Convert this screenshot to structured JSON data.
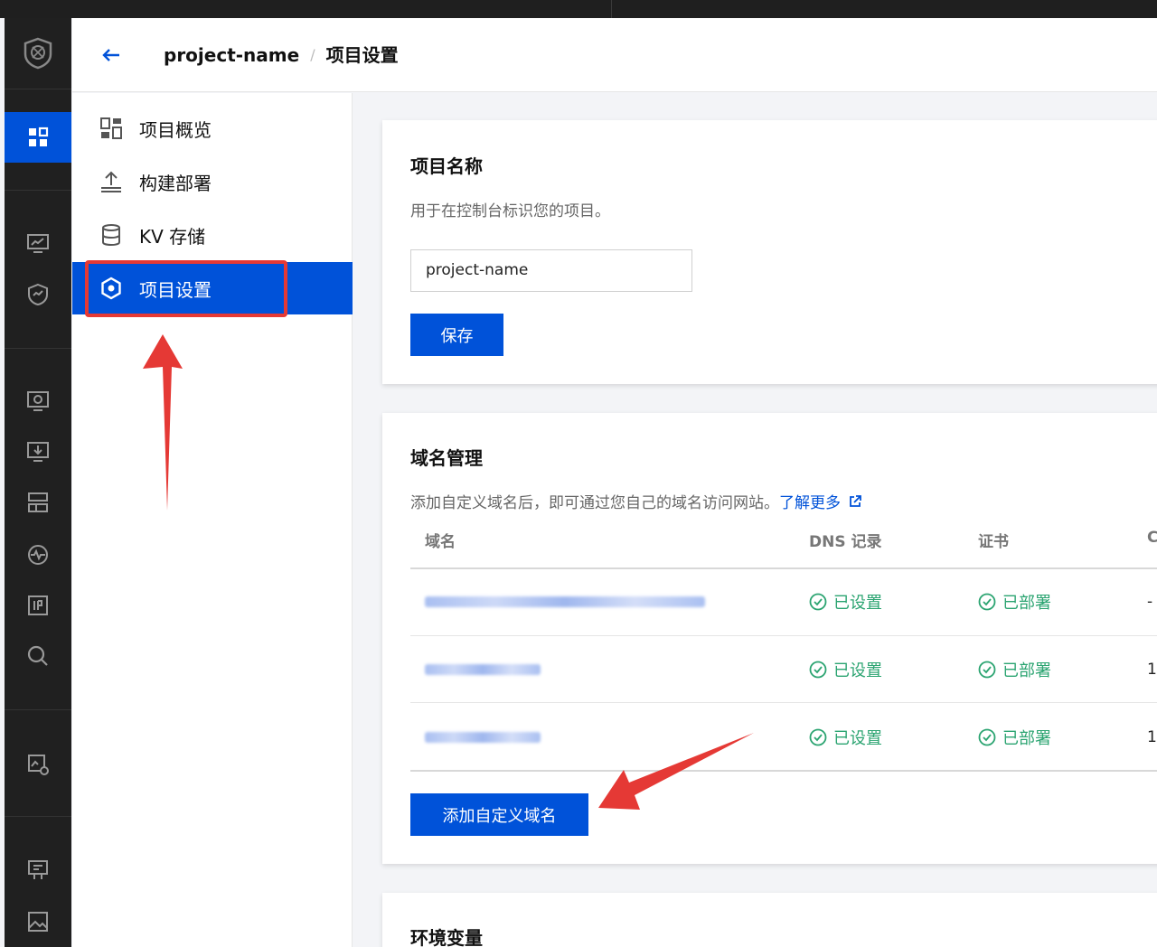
{
  "header": {
    "back_icon": "arrow-left-icon",
    "project": "project-name",
    "separator": "/",
    "page": "项目设置"
  },
  "sidenav": {
    "items": [
      {
        "label": "项目概览",
        "icon": "dashboard-icon"
      },
      {
        "label": "构建部署",
        "icon": "upload-icon"
      },
      {
        "label": "KV 存储",
        "icon": "database-icon"
      },
      {
        "label": "项目设置",
        "icon": "settings-icon",
        "selected": true
      }
    ]
  },
  "project_name_card": {
    "title": "项目名称",
    "description": "用于在控制台标识您的项目。",
    "input_value": "project-name",
    "save_label": "保存"
  },
  "domain_card": {
    "title": "域名管理",
    "description": "添加自定义域名后，即可通过您自己的域名访问网站。",
    "learn_more": "了解更多",
    "columns": [
      "域名",
      "DNS 记录",
      "证书",
      "C"
    ],
    "rows": [
      {
        "dns": "已设置",
        "cert": "已部署",
        "last": "-"
      },
      {
        "dns": "已设置",
        "cert": "已部署",
        "last": "1"
      },
      {
        "dns": "已设置",
        "cert": "已部署",
        "last": "1"
      }
    ],
    "add_label": "添加自定义域名"
  },
  "env_card": {
    "title": "环境变量"
  },
  "colors": {
    "primary": "#0052d9",
    "success": "#2ba471",
    "annotation": "#e53935",
    "rail": "#202020"
  }
}
